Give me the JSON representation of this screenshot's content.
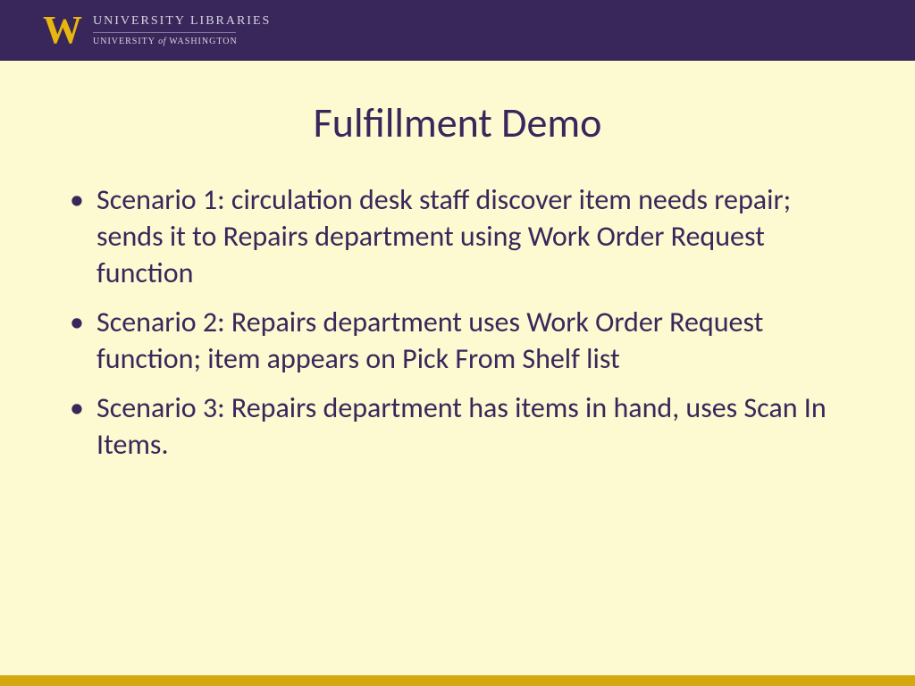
{
  "header": {
    "logo_letter": "W",
    "title": "UNIVERSITY LIBRARIES",
    "subtitle_pre": "UNIVERSITY ",
    "subtitle_of": "of",
    "subtitle_post": " WASHINGTON"
  },
  "slide": {
    "title": "Fulfillment Demo",
    "bullets": [
      "Scenario 1: circulation desk staff discover item needs repair; sends it to Repairs department using Work Order Request function",
      "Scenario 2: Repairs department uses Work Order Request function; item appears on Pick From Shelf list",
      "Scenario 3: Repairs department has items in hand, uses Scan In Items."
    ]
  }
}
